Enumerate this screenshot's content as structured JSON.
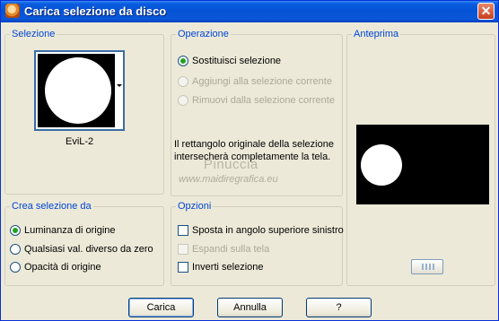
{
  "window": {
    "title": "Carica selezione da disco",
    "close": "✕"
  },
  "selezione": {
    "legend": "Selezione",
    "selected_item": "EviL-2"
  },
  "operazione": {
    "legend": "Operazione",
    "options": [
      {
        "label": "Sostituisci selezione",
        "checked": true,
        "enabled": true
      },
      {
        "label": "Aggiungi alla selezione corrente",
        "checked": false,
        "enabled": false
      },
      {
        "label": "Rimuovi dalla selezione corrente",
        "checked": false,
        "enabled": false
      }
    ],
    "info": "Il rettangolo originale della selezione intersecherà completamente la tela."
  },
  "watermark": {
    "line1": "Pinuccia",
    "line2": "www.maidiregrafica.eu"
  },
  "anteprima": {
    "legend": "Anteprima"
  },
  "crea_selezione": {
    "legend": "Crea selezione da",
    "options": [
      {
        "label": "Luminanza di origine",
        "checked": true
      },
      {
        "label": "Qualsiasi val. diverso da zero",
        "checked": false
      },
      {
        "label": "Opacità di origine",
        "checked": false
      }
    ]
  },
  "opzioni": {
    "legend": "Opzioni",
    "options": [
      {
        "label": "Sposta in angolo superiore sinistro",
        "checked": false,
        "enabled": true
      },
      {
        "label": "Espandi sulla tela",
        "checked": false,
        "enabled": false
      },
      {
        "label": "Inverti selezione",
        "checked": false,
        "enabled": true
      }
    ]
  },
  "buttons": {
    "load": "Carica",
    "cancel": "Annulla",
    "help": "?"
  },
  "colors": {
    "titlebar": "#0a5ee0",
    "legend_text": "#0046d5",
    "dialog_bg": "#ece9d8",
    "radio_dot": "#21a121"
  }
}
